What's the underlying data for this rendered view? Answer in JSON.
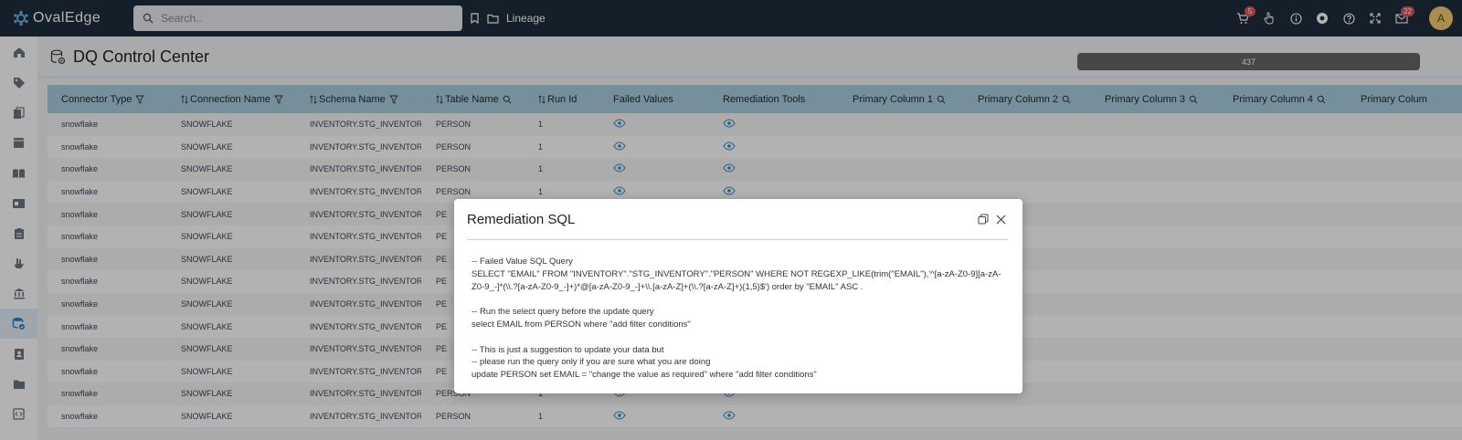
{
  "app": {
    "name": "OvalEdge"
  },
  "header": {
    "search_placeholder": "Search..",
    "nav_label": "Lineage",
    "cart_badge": "5",
    "mail_badge": "22",
    "avatar_initial": "A"
  },
  "page": {
    "title": "DQ Control Center",
    "progress_value": "437"
  },
  "table": {
    "columns": [
      "Connector Type",
      "Connection Name",
      "Schema Name",
      "Table Name",
      "Run Id",
      "Failed Values",
      "Remediation Tools",
      "Primary Column 1",
      "Primary Column 2",
      "Primary Column 3",
      "Primary Column 4",
      "Primary Colum"
    ],
    "rows": [
      [
        "snowflake",
        "SNOWFLAKE",
        "INVENTORY.STG_INVENTORY",
        "PERSON",
        "1"
      ],
      [
        "snowflake",
        "SNOWFLAKE",
        "INVENTORY.STG_INVENTORY",
        "PERSON",
        "1"
      ],
      [
        "snowflake",
        "SNOWFLAKE",
        "INVENTORY.STG_INVENTORY",
        "PERSON",
        "1"
      ],
      [
        "snowflake",
        "SNOWFLAKE",
        "INVENTORY.STG_INVENTORY",
        "PERSON",
        "1"
      ],
      [
        "snowflake",
        "SNOWFLAKE",
        "INVENTORY.STG_INVENTORY",
        "PE",
        ""
      ],
      [
        "snowflake",
        "SNOWFLAKE",
        "INVENTORY.STG_INVENTORY",
        "PE",
        ""
      ],
      [
        "snowflake",
        "SNOWFLAKE",
        "INVENTORY.STG_INVENTORY",
        "PE",
        ""
      ],
      [
        "snowflake",
        "SNOWFLAKE",
        "INVENTORY.STG_INVENTORY",
        "PE",
        ""
      ],
      [
        "snowflake",
        "SNOWFLAKE",
        "INVENTORY.STG_INVENTORY",
        "PE",
        ""
      ],
      [
        "snowflake",
        "SNOWFLAKE",
        "INVENTORY.STG_INVENTORY",
        "PE",
        ""
      ],
      [
        "snowflake",
        "SNOWFLAKE",
        "INVENTORY.STG_INVENTORY",
        "PE",
        ""
      ],
      [
        "snowflake",
        "SNOWFLAKE",
        "INVENTORY.STG_INVENTORY",
        "PE",
        ""
      ],
      [
        "snowflake",
        "SNOWFLAKE",
        "INVENTORY.STG_INVENTORY",
        "PERSON",
        "1"
      ],
      [
        "snowflake",
        "SNOWFLAKE",
        "INVENTORY.STG_INVENTORY",
        "PERSON",
        "1"
      ]
    ]
  },
  "modal": {
    "title": "Remediation SQL",
    "lines": [
      "-- Failed Value SQL Query",
      "SELECT \"EMAIL\" FROM \"INVENTORY\".\"STG_INVENTORY\".\"PERSON\" WHERE NOT REGEXP_LIKE(trim(\"EMAIL\"),'^[a-zA-Z0-9][a-zA-Z0-9_-]*(\\\\.?[a-zA-Z0-9_-]+)*@[a-zA-Z0-9_-]+\\\\.[a-zA-Z]+(\\\\.?[a-zA-Z]+){1,5}$') order by \"EMAIL\" ASC .",
      "",
      "-- Run the select query before the update query",
      "select EMAIL from PERSON where \"add filter conditions\"",
      "",
      "-- This is just a suggestion to update your data but",
      "-- please run the query only if you are sure what you are doing",
      "update PERSON set EMAIL = \"change the value as required\" where \"add filter conditions\""
    ]
  },
  "colors": {
    "topbar": "#1f2d3d",
    "table_header": "#a9cede",
    "eye_icon": "#3a8fc2",
    "badge": "#e05656"
  }
}
